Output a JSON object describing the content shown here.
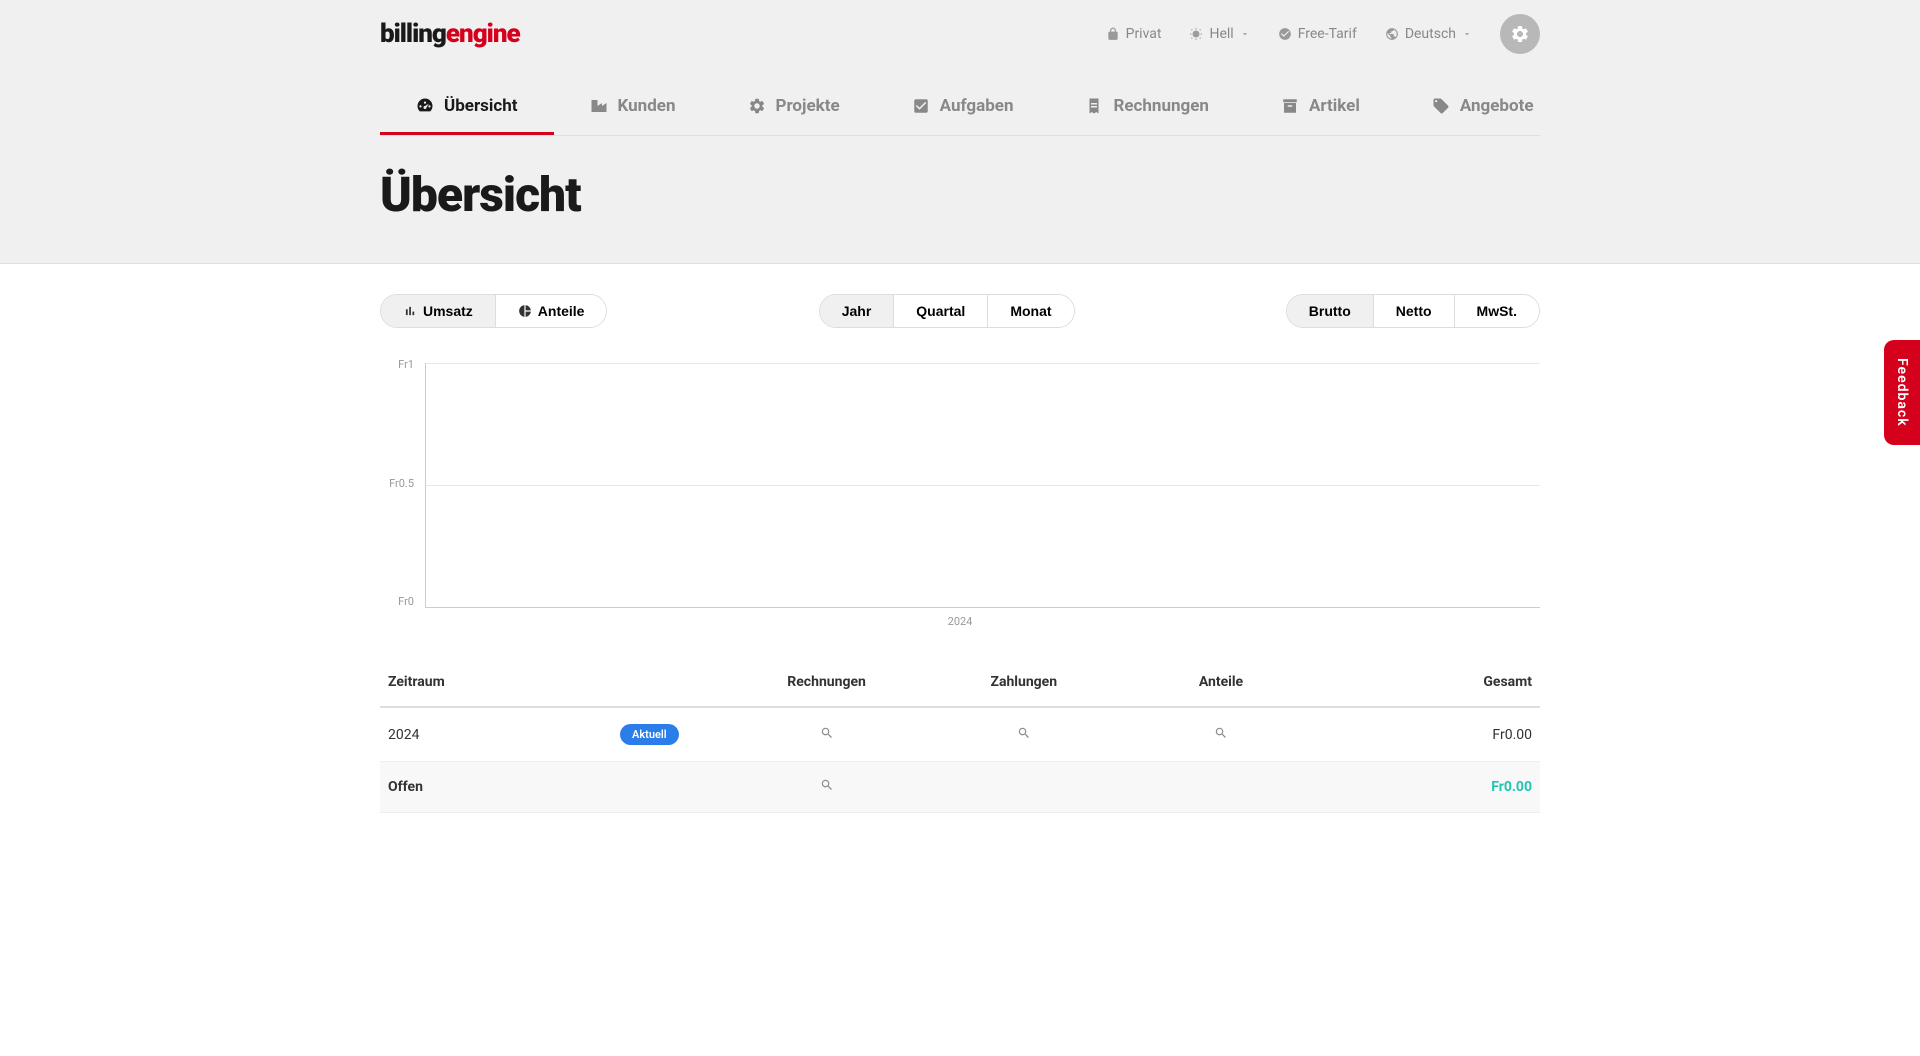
{
  "logo": {
    "part1": "billing",
    "part2": "engine"
  },
  "top_links": {
    "privacy": "Privat",
    "theme": "Hell",
    "plan": "Free-Tarif",
    "language": "Deutsch"
  },
  "nav": {
    "items": [
      {
        "label": "Übersicht"
      },
      {
        "label": "Kunden"
      },
      {
        "label": "Projekte"
      },
      {
        "label": "Aufgaben"
      },
      {
        "label": "Rechnungen"
      },
      {
        "label": "Artikel"
      },
      {
        "label": "Angebote"
      }
    ]
  },
  "page_title": "Übersicht",
  "toggles": {
    "view": {
      "umsatz": "Umsatz",
      "anteile": "Anteile"
    },
    "period": {
      "jahr": "Jahr",
      "quartal": "Quartal",
      "monat": "Monat"
    },
    "tax": {
      "brutto": "Brutto",
      "netto": "Netto",
      "mwst": "MwSt."
    }
  },
  "chart_data": {
    "type": "bar",
    "categories": [
      "2024"
    ],
    "values": [
      0
    ],
    "title": "",
    "xlabel": "",
    "ylabel": "",
    "ylim": [
      0,
      1
    ],
    "y_ticks": [
      "Fr1",
      "Fr0.5",
      "Fr0"
    ],
    "x_tick": "2024"
  },
  "table": {
    "headers": {
      "zeitraum": "Zeitraum",
      "rechnungen": "Rechnungen",
      "zahlungen": "Zahlungen",
      "anteile": "Anteile",
      "gesamt": "Gesamt"
    },
    "rows": [
      {
        "period": "2024",
        "badge": "Aktuell",
        "total": "Fr0.00"
      }
    ],
    "footer": {
      "label": "Offen",
      "total": "Fr0.00"
    }
  },
  "feedback_label": "Feedback"
}
